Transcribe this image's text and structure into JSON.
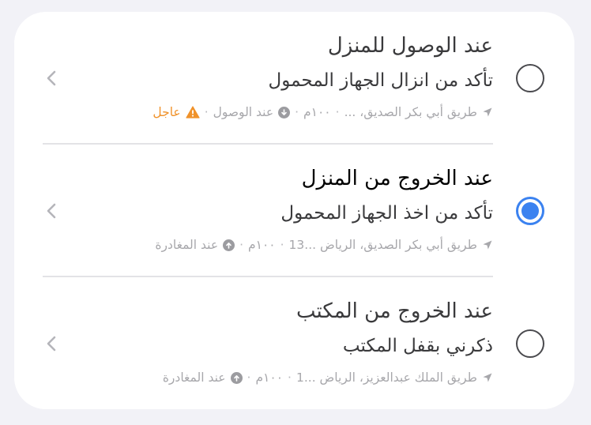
{
  "colors": {
    "accent": "#3b82f0",
    "urgent": "#f0922a",
    "meta_text": "#a7a7ab",
    "background": "#f2f2f7",
    "card": "#ffffff"
  },
  "reminders": [
    {
      "title": "عند الوصول للمنزل",
      "subtitle": "تأكد من انزال الجهاز المحمول",
      "location": "طريق أبي بكر الصديق، ...",
      "distance": "١٠٠م",
      "trigger_label": "عند الوصول",
      "trigger_icon": "arrow-down-circle-icon",
      "urgent_label": "عاجل",
      "urgent_icon": "warning-triangle-icon",
      "selected": false
    },
    {
      "title": "عند الخروج من المنزل",
      "subtitle": "تأكد من اخذ الجهاز المحمول",
      "location": "طريق أبي بكر الصديق، الرياض ...13",
      "distance": "١٠٠م",
      "trigger_label": "عند المغادرة",
      "trigger_icon": "arrow-up-circle-icon",
      "selected": true
    },
    {
      "title": "عند الخروج من المكتب",
      "subtitle": "ذكرني بقفل المكتب",
      "location": "طريق الملك عبدالعزيز، الرياض ...1",
      "distance": "١٠٠م",
      "trigger_label": "عند المغادرة",
      "trigger_icon": "arrow-up-circle-icon",
      "selected": false
    }
  ],
  "separator": "·"
}
